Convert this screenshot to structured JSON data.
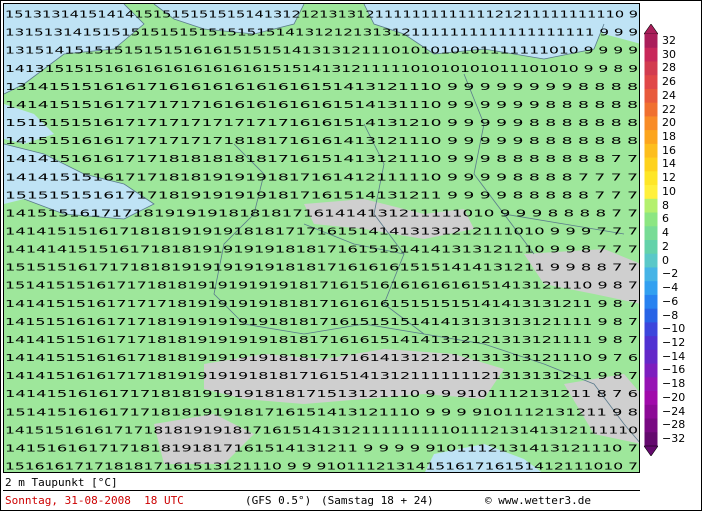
{
  "footer": {
    "title": "2 m Taupunkt [°C]",
    "date": "Sonntag, 31-08-2008  18 UTC",
    "model": "(GFS 0.5°)",
    "run": "(Samstag 18 + 24)",
    "copyright": "© www.wetter3.de"
  },
  "colorbar": {
    "labels": [
      "32",
      "30",
      "28",
      "26",
      "24",
      "22",
      "20",
      "18",
      "16",
      "14",
      "12",
      "10",
      "8",
      "6",
      "4",
      "2",
      "0",
      "−2",
      "−4",
      "−6",
      "−8",
      "−10",
      "−12",
      "−14",
      "−16",
      "−18",
      "−20",
      "−24",
      "−28",
      "−32"
    ],
    "colors": [
      "#aa1e5a",
      "#c8285a",
      "#d23c50",
      "#e04848",
      "#e85a3c",
      "#f07030",
      "#f88c28",
      "#fca51e",
      "#fdbe1e",
      "#fed21e",
      "#fee628",
      "#fff03c",
      "#b4f06e",
      "#8ce682",
      "#78dc96",
      "#64d2aa",
      "#5ac8c8",
      "#46b4e6",
      "#32a0f0",
      "#2882f0",
      "#2864e6",
      "#3c46dc",
      "#5032d2",
      "#6428c8",
      "#7d1ebe",
      "#9614b4",
      "#a00aaa",
      "#8c0a96",
      "#780a82",
      "#640a6e"
    ]
  },
  "map": {
    "land_color": "#9ee79b",
    "sea_color": "#bfe3f5",
    "mountain_color": "#cfcfcf",
    "value_rows": [
      "1513131415141415151515151514131212131312111111111111121211111111110 9",
      "1315131415151515151515151515141312121313121111111111111111111 9 9 9",
      "1315141515151515151616151515141313121110101010101111111010 9 9 9 9",
      "1413151515161616161616161615151413121111101010101011101010 9 9 8 9",
      "1314151516161716161616161616151413121110 9 9 9 9 9 9 9 9 8 8 8 8",
      "1414151516171717171616161616161514131110 9 9 9 9 9 9 8 8 8 8 8 8",
      "1515151516171717171717171716161514131210 9 9 9 9 9 8 8 8 8 8 8 8",
      "1415151616171717171718181716161413121110 9 9 9 9 9 8 8 8 8 8 8 8",
      "1414151616171718181818181716151413121110 9 9 9 8 8 8 8 8 8 8 7 7",
      "1414151516171718181919191817161412111110 9 9 9 9 8 8 8 8 7 7 7 7",
      "1515151516171718191919191817161514131211 9 9 9 9 8 8 8 8 8 7 7 7",
      "1415151617171819191918181817161414131211111010 9 9 9 8 8 8 8 7 7",
      "1414151516171818191919181817171615141413131212111010 9 9 9 7 7 7",
      "1414141515161718181919191918181716151514141313121110 9 9 8 7 7 7",
      "1515151617171818191919191918181716161615151414131211 9 9 8 8 7 7",
      "1514151516171718181919191919181716151616161616151413121110 9 8 7",
      "1414151516171717181919191918181716161615151515141413131211 9 8 7",
      "1415151616171718191919191918181716151515141413131313121111 9 8 7",
      "1414151516171718181919191918181716161514141312121313121111 9 8 7",
      "1414151516161718181919191918181717161413121212131313121110 9 7 6",
      "1414151616171718191919191818171615141312111111121313131211 9 8 7",
      "1414151616171718181919191818171513121110 9 9 9101112131211 8 7 6",
      "1514151616171718181919181716151413121110 9 9 9 9101112131211 9 8",
      "1415151616171718181919181716151413121111111110111213141312111110",
      "1415161617171818191817161514131211 9 9 9 9 9101112131413121110 7",
      "1516161717181817161513121110 9 9 9101112131415161716151412111010 7"
    ]
  }
}
